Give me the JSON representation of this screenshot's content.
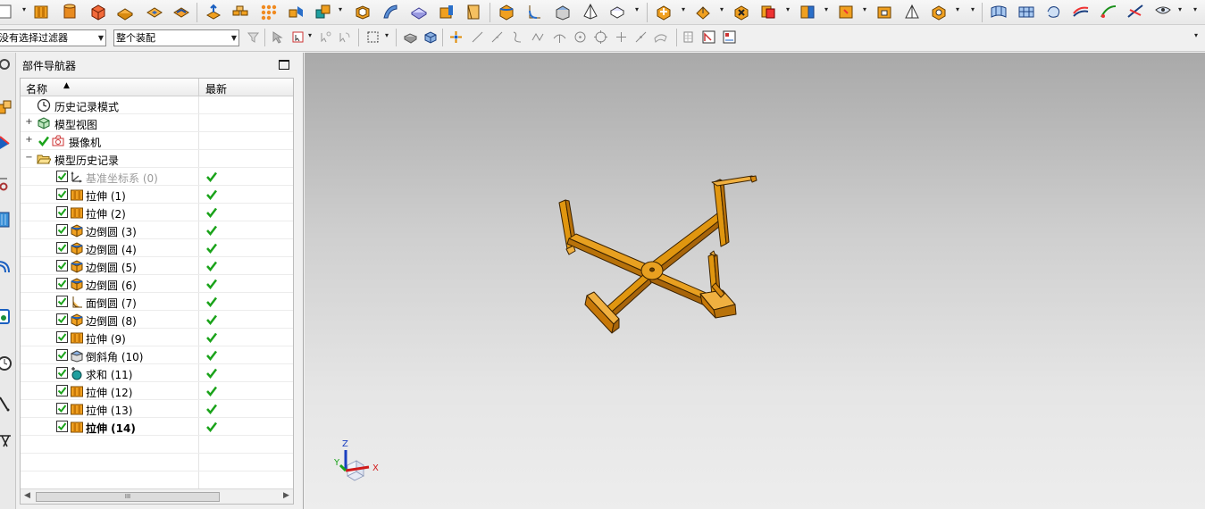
{
  "selection_bar": {
    "filter": "没有选择过滤器",
    "scope": "整个装配"
  },
  "navigator": {
    "title": "部件导航器",
    "columns": {
      "name": "名称",
      "latest": "最新"
    },
    "top_nodes": [
      {
        "label": "历史记录模式",
        "icon": "clock-icon"
      },
      {
        "label": "模型视图",
        "icon": "model-views-icon"
      },
      {
        "label": "摄像机",
        "icon": "camera-icon"
      },
      {
        "label": "模型历史记录",
        "icon": "folder-open-icon"
      }
    ],
    "features": [
      {
        "label": "基准坐标系 (0)",
        "icon": "datum-csys-icon",
        "dim": true,
        "bold": false
      },
      {
        "label": "拉伸 (1)",
        "icon": "extrude-icon",
        "dim": false,
        "bold": false
      },
      {
        "label": "拉伸 (2)",
        "icon": "extrude-icon",
        "dim": false,
        "bold": false
      },
      {
        "label": "边倒圆 (3)",
        "icon": "edge-blend-icon",
        "dim": false,
        "bold": false
      },
      {
        "label": "边倒圆 (4)",
        "icon": "edge-blend-icon",
        "dim": false,
        "bold": false
      },
      {
        "label": "边倒圆 (5)",
        "icon": "edge-blend-icon",
        "dim": false,
        "bold": false
      },
      {
        "label": "边倒圆 (6)",
        "icon": "edge-blend-icon",
        "dim": false,
        "bold": false
      },
      {
        "label": "面倒圆 (7)",
        "icon": "face-blend-icon",
        "dim": false,
        "bold": false
      },
      {
        "label": "边倒圆 (8)",
        "icon": "edge-blend-icon",
        "dim": false,
        "bold": false
      },
      {
        "label": "拉伸 (9)",
        "icon": "extrude-icon",
        "dim": false,
        "bold": false
      },
      {
        "label": "倒斜角 (10)",
        "icon": "chamfer-icon",
        "dim": false,
        "bold": false
      },
      {
        "label": "求和 (11)",
        "icon": "unite-icon",
        "dim": false,
        "bold": false
      },
      {
        "label": "拉伸 (12)",
        "icon": "extrude-icon",
        "dim": false,
        "bold": false
      },
      {
        "label": "拉伸 (13)",
        "icon": "extrude-icon",
        "dim": false,
        "bold": false
      },
      {
        "label": "拉伸 (14)",
        "icon": "extrude-icon",
        "dim": false,
        "bold": true
      }
    ]
  },
  "triad": {
    "x": "X",
    "y": "Y",
    "z": "Z"
  },
  "colors": {
    "model": "#e0960f",
    "model_edge": "#3b2200",
    "check_green": "#1aa31a",
    "accent_blue": "#2a6fc9"
  }
}
